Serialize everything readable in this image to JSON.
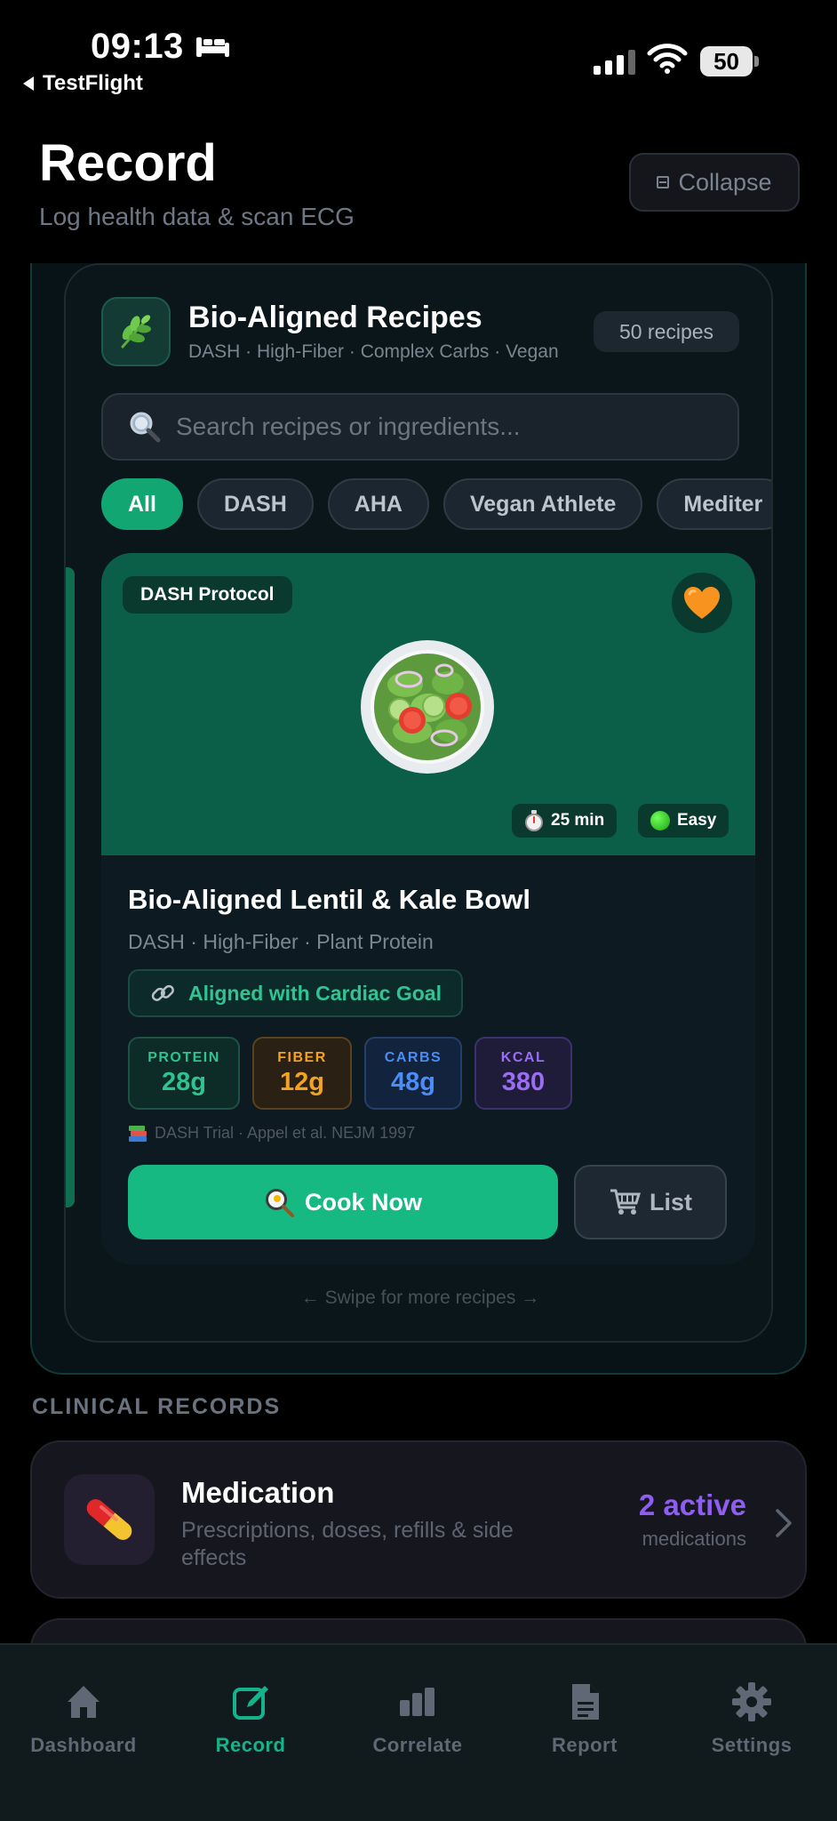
{
  "status_bar": {
    "time": "09:13",
    "back_app": "TestFlight",
    "battery": "50"
  },
  "header": {
    "title": "Record",
    "subtitle": "Log health data & scan ECG",
    "collapse_label": "Collapse"
  },
  "recipes": {
    "icon": "herb-icon",
    "title": "Bio-Aligned Recipes",
    "subtitle": "DASH · High-Fiber · Complex Carbs · Vegan",
    "count_label": "50 recipes",
    "search_placeholder": "Search recipes or ingredients...",
    "filters": [
      "All",
      "DASH",
      "AHA",
      "Vegan Athlete",
      "Mediter"
    ],
    "active_filter": "All",
    "card": {
      "protocol": "DASH Protocol",
      "favorite_icon": "orange-heart-icon",
      "image_icon": "salad-icon",
      "time": "25 min",
      "difficulty": "Easy",
      "name": "Bio-Aligned Lentil & Kale Bowl",
      "tags": "DASH · High-Fiber · Plant Protein",
      "goal": "Aligned with Cardiac Goal",
      "macros": [
        {
          "label": "PROTEIN",
          "value": "28g"
        },
        {
          "label": "FIBER",
          "value": "12g"
        },
        {
          "label": "CARBS",
          "value": "48g"
        },
        {
          "label": "KCAL",
          "value": "380"
        }
      ],
      "citation": "DASH Trial · Appel et al. NEJM 1997",
      "cook_label": "Cook Now",
      "list_label": "List"
    },
    "swipe_hint": "← Swipe for more recipes →"
  },
  "clinical": {
    "section_label": "CLINICAL RECORDS",
    "medication": {
      "title": "Medication",
      "description": "Prescriptions, doses, refills & side effects",
      "count": "2 active",
      "count_sub": "medications"
    }
  },
  "tabs": [
    {
      "label": "Dashboard",
      "icon": "home-icon"
    },
    {
      "label": "Record",
      "icon": "edit-icon",
      "active": true
    },
    {
      "label": "Correlate",
      "icon": "bar-chart-icon"
    },
    {
      "label": "Report",
      "icon": "document-icon"
    },
    {
      "label": "Settings",
      "icon": "gear-icon"
    }
  ],
  "colors": {
    "accent": "#16b981",
    "background": "#000000",
    "purple": "#8e5ef2"
  }
}
